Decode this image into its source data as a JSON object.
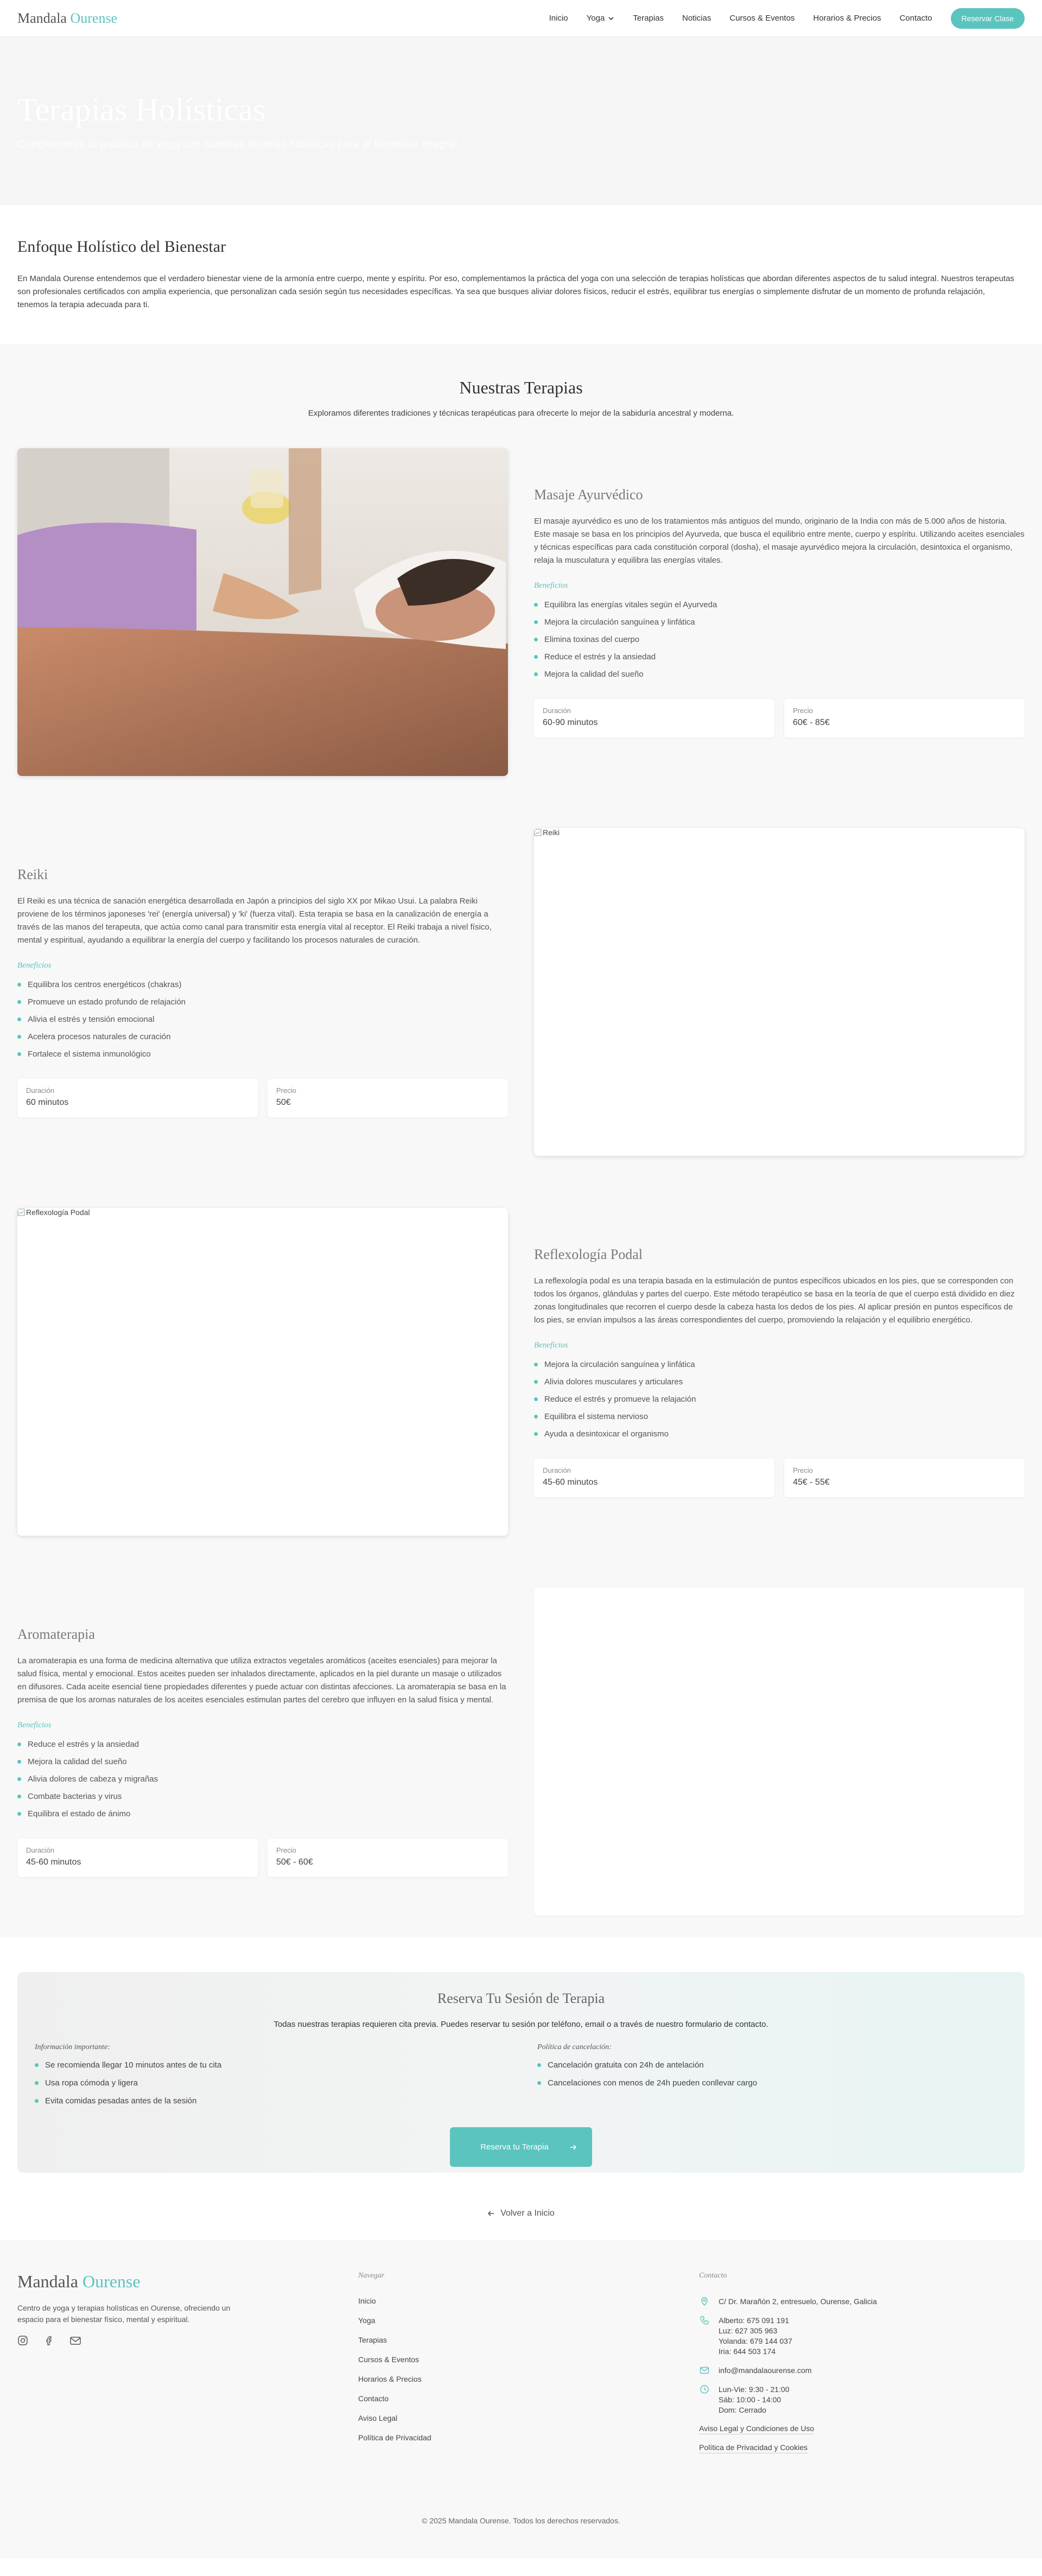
{
  "header": {
    "logo_main": "Mandala",
    "logo_accent": "Ourense",
    "nav": [
      {
        "label": "Inicio"
      },
      {
        "label": "Yoga"
      },
      {
        "label": "Terapias"
      },
      {
        "label": "Noticias"
      },
      {
        "label": "Cursos & Eventos"
      },
      {
        "label": "Horarios & Precios"
      },
      {
        "label": "Contacto"
      }
    ],
    "cta": "Reservar Clase"
  },
  "hero": {
    "title": "Terapias Holísticas",
    "subtitle": "Complementa tu práctica de yoga con nuestras terapias holísticas para el bienestar integral"
  },
  "intro": {
    "title": "Enfoque Holístico del Bienestar",
    "text": "En Mandala Ourense entendemos que el verdadero bienestar viene de la armonía entre cuerpo, mente y espíritu. Por eso, complementamos la práctica del yoga con una selección de terapias holísticas que abordan diferentes aspectos de tu salud integral. Nuestros terapeutas son profesionales certificados con amplia experiencia, que personalizan cada sesión según tus necesidades específicas. Ya sea que busques aliviar dolores físicos, reducir el estrés, equilibrar tus energías o simplemente disfrutar de un momento de profunda relajación, tenemos la terapia adecuada para ti."
  },
  "therapies_section": {
    "title": "Nuestras Terapias",
    "subtitle": "Exploramos diferentes tradiciones y técnicas terapéuticas para ofrecerte lo mejor de la sabiduría ancestral y moderna.",
    "benefits_label": "Beneficios",
    "duration_label": "Duración",
    "price_label": "Precio"
  },
  "therapies": [
    {
      "title": "Masaje Ayurvédico",
      "image_alt": "",
      "description": "El masaje ayurvédico es uno de los tratamientos más antiguos del mundo, originario de la India con más de 5.000 años de historia. Este masaje se basa en los principios del Ayurveda, que busca el equilibrio entre mente, cuerpo y espíritu. Utilizando aceites esenciales y técnicas específicas para cada constitución corporal (dosha), el masaje ayurvédico mejora la circulación, desintoxica el organismo, relaja la musculatura y equilibra las energías vitales.",
      "benefits": [
        "Equilibra las energías vitales según el Ayurveda",
        "Mejora la circulación sanguínea y linfática",
        "Elimina toxinas del cuerpo",
        "Reduce el estrés y la ansiedad",
        "Mejora la calidad del sueño"
      ],
      "duration": "60-90 minutos",
      "price": "60€ - 85€"
    },
    {
      "title": "Reiki",
      "image_alt": "Reiki",
      "description": "El Reiki es una técnica de sanación energética desarrollada en Japón a principios del siglo XX por Mikao Usui. La palabra Reiki proviene de los términos japoneses 'rei' (energía universal) y 'ki' (fuerza vital). Esta terapia se basa en la canalización de energía a través de las manos del terapeuta, que actúa como canal para transmitir esta energía vital al receptor. El Reiki trabaja a nivel físico, mental y espiritual, ayudando a equilibrar la energía del cuerpo y facilitando los procesos naturales de curación.",
      "benefits": [
        "Equilibra los centros energéticos (chakras)",
        "Promueve un estado profundo de relajación",
        "Alivia el estrés y tensión emocional",
        "Acelera procesos naturales de curación",
        "Fortalece el sistema inmunológico"
      ],
      "duration": "60 minutos",
      "price": "50€"
    },
    {
      "title": "Reflexología Podal",
      "image_alt": "Reflexología Podal",
      "description": "La reflexología podal es una terapia basada en la estimulación de puntos específicos ubicados en los pies, que se corresponden con todos los órganos, glándulas y partes del cuerpo. Este método terapéutico se basa en la teoría de que el cuerpo está dividido en diez zonas longitudinales que recorren el cuerpo desde la cabeza hasta los dedos de los pies. Al aplicar presión en puntos específicos de los pies, se envían impulsos a las áreas correspondientes del cuerpo, promoviendo la relajación y el equilibrio energético.",
      "benefits": [
        "Mejora la circulación sanguínea y linfática",
        "Alivia dolores musculares y articulares",
        "Reduce el estrés y promueve la relajación",
        "Equilibra el sistema nervioso",
        "Ayuda a desintoxicar el organismo"
      ],
      "duration": "45-60 minutos",
      "price": "45€ - 55€"
    },
    {
      "title": "Aromaterapia",
      "image_alt": "",
      "description": "La aromaterapia es una forma de medicina alternativa que utiliza extractos vegetales aromáticos (aceites esenciales) para mejorar la salud física, mental y emocional. Estos aceites pueden ser inhalados directamente, aplicados en la piel durante un masaje o utilizados en difusores. Cada aceite esencial tiene propiedades diferentes y puede actuar con distintas afecciones. La aromaterapia se basa en la premisa de que los aromas naturales de los aceites esenciales estimulan partes del cerebro que influyen en la salud física y mental.",
      "benefits": [
        "Reduce el estrés y la ansiedad",
        "Mejora la calidad del sueño",
        "Alivia dolores de cabeza y migrañas",
        "Combate bacterias y virus",
        "Equilibra el estado de ánimo"
      ],
      "duration": "45-60 minutos",
      "price": "50€ - 60€"
    }
  ],
  "reservation": {
    "title": "Reserva Tu Sesión de Terapia",
    "subtitle": "Todas nuestras terapias requieren cita previa. Puedes reservar tu sesión por teléfono, email o a través de nuestro formulario de contacto.",
    "info_title": "Información importante:",
    "info_items": [
      "Se recomienda llegar 10 minutos antes de tu cita",
      "Usa ropa cómoda y ligera",
      "Evita comidas pesadas antes de la sesión"
    ],
    "policy_title": "Política de cancelación:",
    "policy_items": [
      "Cancelación gratuita con 24h de antelación",
      "Cancelaciones con menos de 24h pueden conllevar cargo"
    ],
    "button": "Reserva tu Terapia"
  },
  "back_link": "Volver a Inicio",
  "footer": {
    "logo_main": "Mandala",
    "logo_accent": "Ourense",
    "description": "Centro de yoga y terapias holísticas en Ourense, ofreciendo un espacio para el bienestar físico, mental y espiritual.",
    "social_icons": [
      "instagram-icon",
      "facebook-icon",
      "mail-icon"
    ],
    "nav_title": "Navegar",
    "nav_links": [
      "Inicio",
      "Yoga",
      "Terapias",
      "Cursos & Eventos",
      "Horarios & Precios",
      "Contacto",
      "Aviso Legal",
      "Política de Privacidad"
    ],
    "contact_title": "Contacto",
    "address": "C/ Dr. Marañón 2, entresuelo, Ourense, Galicia",
    "phones": [
      "Alberto: 675 091 191",
      "Luz: 627 305 963",
      "Yolanda: 679 144 037",
      "Iria: 644 503 174"
    ],
    "email": "info@mandalaourense.com",
    "hours": [
      "Lun-Vie: 9:30 - 21:00",
      "Sáb: 10:00 - 14:00",
      "Dom: Cerrado"
    ],
    "legal_links": [
      "Aviso Legal y Condiciones de Uso",
      "Política de Privacidad y Cookies"
    ],
    "copyright": "© 2025 Mandala Ourense. Todos los derechos reservados."
  },
  "colors": {
    "accent": "#5bc4be",
    "text": "#333333",
    "muted_bg": "#f8f8f8"
  }
}
